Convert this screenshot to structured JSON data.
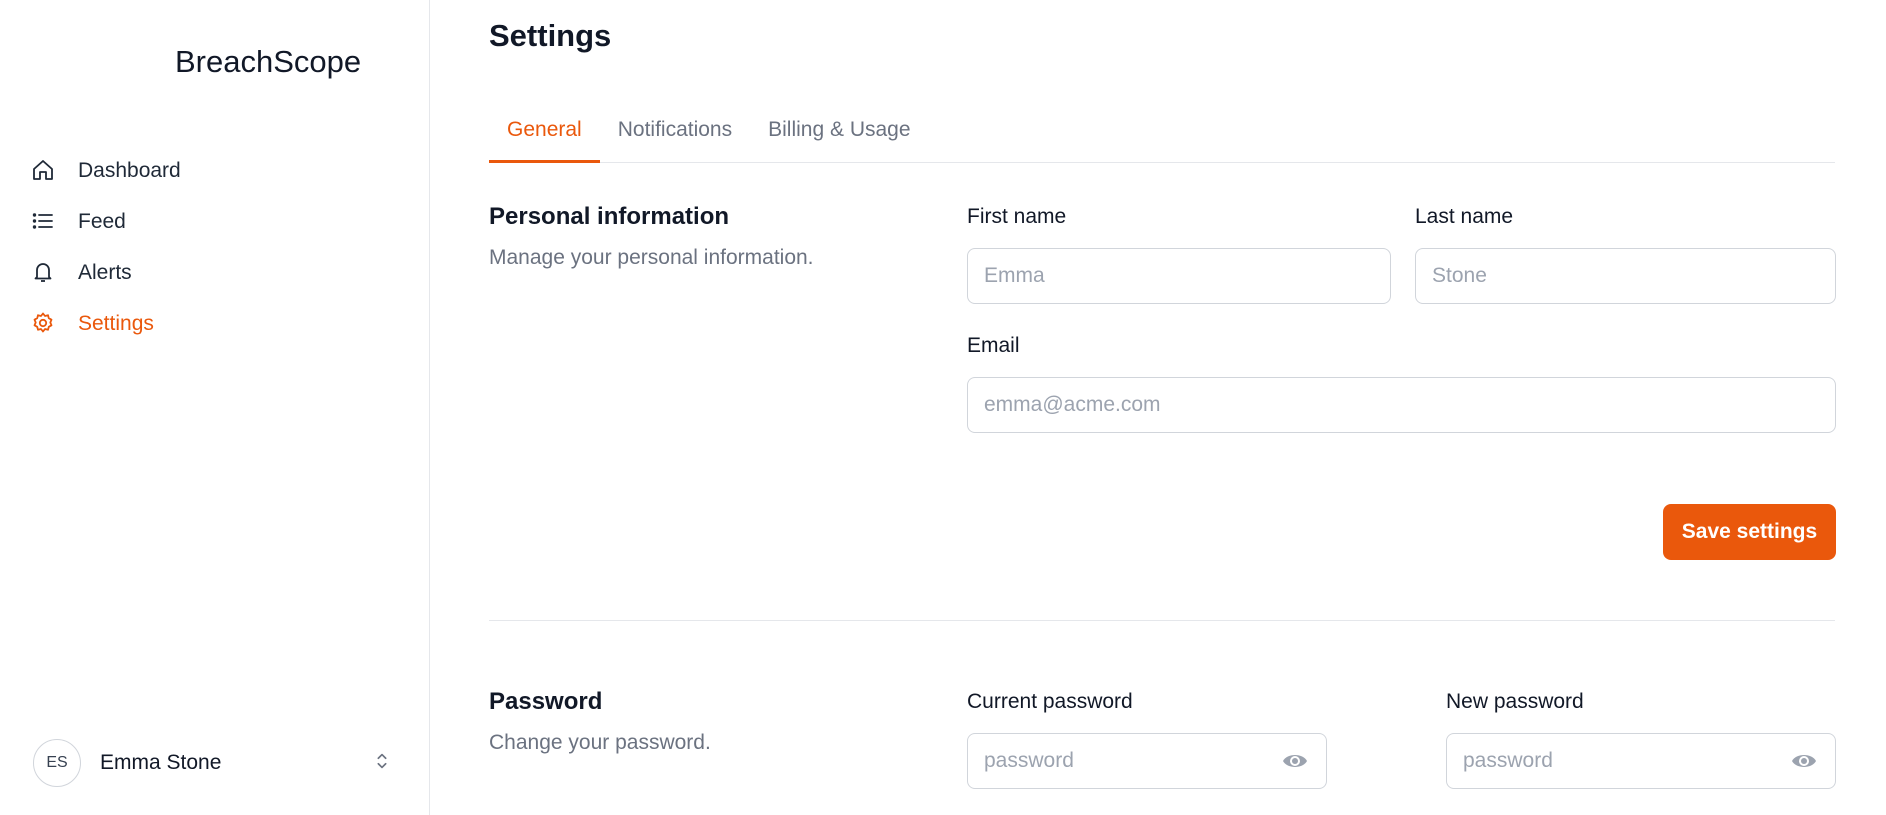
{
  "app": {
    "name": "BreachScope"
  },
  "sidebar": {
    "items": [
      {
        "label": "Dashboard",
        "icon": "home-icon",
        "active": false
      },
      {
        "label": "Feed",
        "icon": "list-icon",
        "active": false
      },
      {
        "label": "Alerts",
        "icon": "bell-icon",
        "active": false
      },
      {
        "label": "Settings",
        "icon": "gear-icon",
        "active": true
      }
    ],
    "user": {
      "initials": "ES",
      "name": "Emma Stone"
    }
  },
  "page": {
    "title": "Settings"
  },
  "tabs": [
    {
      "label": "General",
      "active": true
    },
    {
      "label": "Notifications",
      "active": false
    },
    {
      "label": "Billing & Usage",
      "active": false
    }
  ],
  "personal": {
    "title": "Personal information",
    "description": "Manage your personal information.",
    "first_name_label": "First name",
    "first_name_placeholder": "Emma",
    "last_name_label": "Last name",
    "last_name_placeholder": "Stone",
    "email_label": "Email",
    "email_placeholder": "emma@acme.com",
    "save_label": "Save settings"
  },
  "password": {
    "title": "Password",
    "description": "Change your password.",
    "current_label": "Current password",
    "current_placeholder": "password",
    "new_label": "New password",
    "new_placeholder": "password"
  },
  "colors": {
    "accent": "#ea580c",
    "border": "#d1d5db",
    "muted": "#6b7280"
  }
}
